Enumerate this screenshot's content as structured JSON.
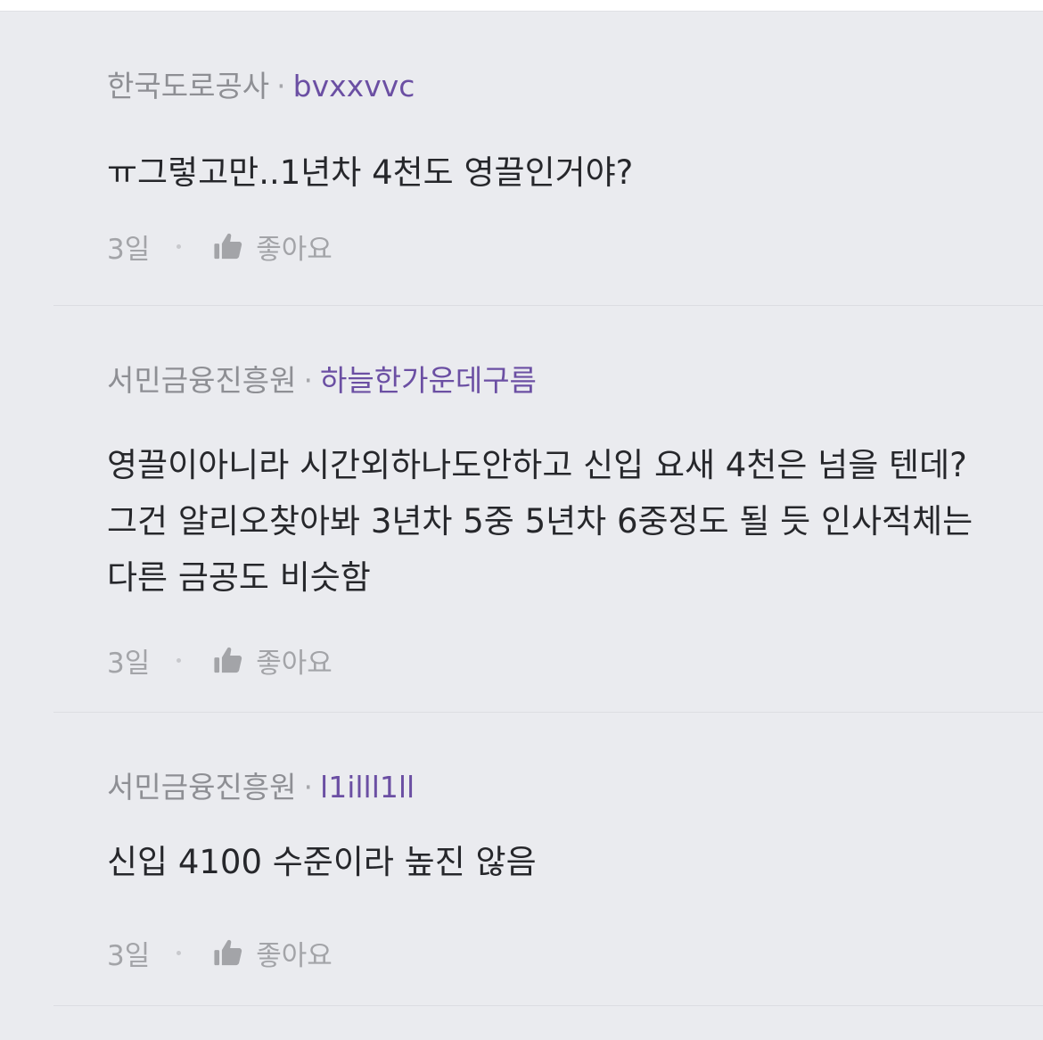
{
  "comments": [
    {
      "company": "한국도로공사",
      "separator": "·",
      "nickname": "bvxxvvc",
      "text": "ㅠ그렇고만..1년차 4천도 영끌인거야?",
      "time": "3일",
      "like_label": "좋아요",
      "like_icon": "thumbs-up-icon"
    },
    {
      "company": "서민금융진흥원",
      "separator": "·",
      "nickname": "하늘한가운데구름",
      "text": "영끌이아니라 시간외하나도안하고 신입 요새 4천은 넘을 텐데? 그건 알리오찾아봐 3년차 5중 5년차 6중정도 될 듯 인사적체는 다른 금공도 비슷함",
      "time": "3일",
      "like_label": "좋아요",
      "like_icon": "thumbs-up-icon"
    },
    {
      "company": "서민금융진흥원",
      "separator": "·",
      "nickname": "l1illl1ll",
      "text": "신입 4100 수준이라 높진 않음",
      "time": "3일",
      "like_label": "좋아요",
      "like_icon": "thumbs-up-icon"
    }
  ],
  "colors": {
    "background": "#eaebef",
    "company": "#8e8f94",
    "nickname": "#6b4fa3",
    "text": "#26272b",
    "meta": "#a3a4a8"
  }
}
